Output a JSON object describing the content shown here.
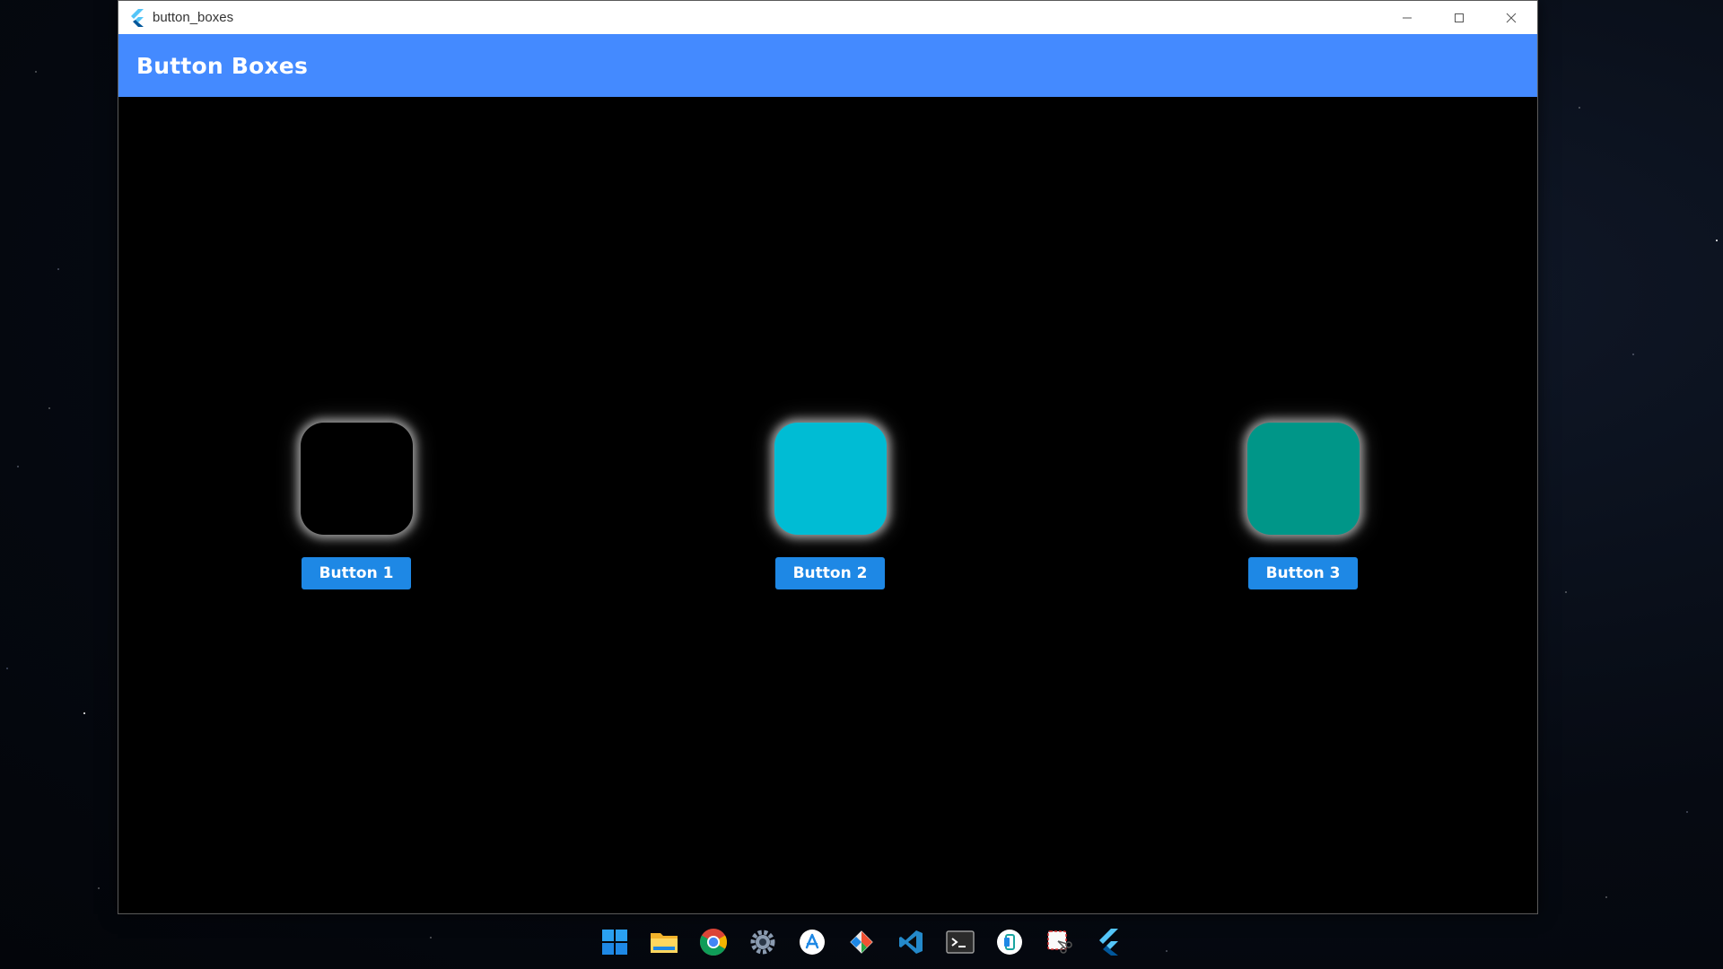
{
  "window": {
    "title": "button_boxes",
    "controls": {
      "minimize": "minimize-icon",
      "maximize": "maximize-icon",
      "close": "close-icon"
    }
  },
  "appbar": {
    "title": "Button Boxes",
    "color": "#448aff"
  },
  "items": [
    {
      "box_color": "#000000",
      "button_label": "Button 1"
    },
    {
      "box_color": "#00bcd4",
      "button_label": "Button 2"
    },
    {
      "box_color": "#009688",
      "button_label": "Button 3"
    }
  ],
  "button_color": "#1e88e5",
  "taskbar": {
    "icons": [
      "windows-start-icon",
      "file-explorer-icon",
      "chrome-icon",
      "settings-icon",
      "app-store-icon",
      "git-icon",
      "vscode-icon",
      "terminal-icon",
      "phone-link-icon",
      "snipping-tool-icon",
      "flutter-icon"
    ]
  }
}
